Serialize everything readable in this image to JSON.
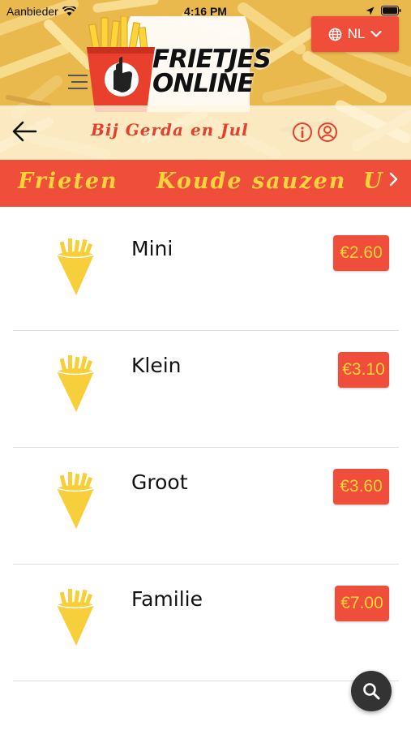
{
  "status_bar": {
    "carrier": "Aanbieder",
    "time": "4:16 PM"
  },
  "header": {
    "language": "NL",
    "logo_line1": "FRIETJES",
    "logo_line2": "ONLINE",
    "shop_name": "Bij Gerda en Jul"
  },
  "tabs": [
    "Frieten",
    "Koude sauzen",
    "U"
  ],
  "products": [
    {
      "name": "Mini",
      "price": "€2.60"
    },
    {
      "name": "Klein",
      "price": "€3.10"
    },
    {
      "name": "Groot",
      "price": "€3.60"
    },
    {
      "name": "Familie",
      "price": "€7.00"
    }
  ],
  "colors": {
    "accent_red": "#ef4e3a",
    "accent_yellow": "#ffd33a",
    "fries_yellow": "#f6cf3a"
  },
  "icons": {
    "menu": "hamburger-icon",
    "back": "back-arrow-icon",
    "info": "info-icon",
    "user": "user-icon",
    "globe": "globe-icon",
    "search": "search-icon"
  }
}
